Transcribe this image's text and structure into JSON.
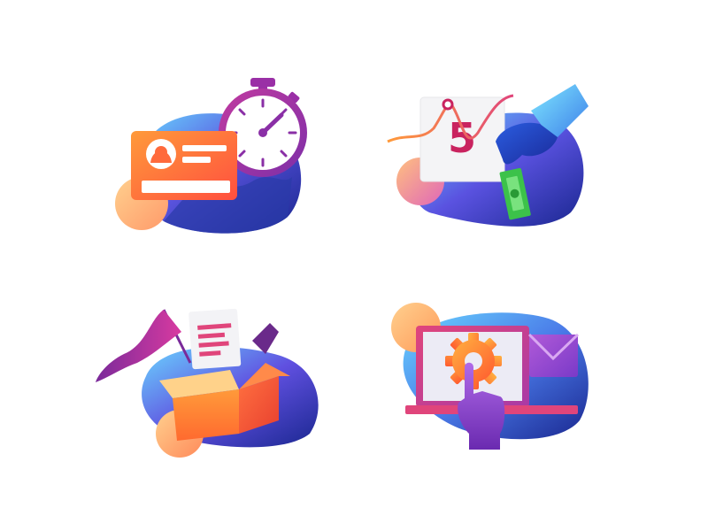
{
  "illustrations": {
    "id_card": {
      "icon": "id-card-stopwatch-icon"
    },
    "calendar": {
      "icon": "calendar-payment-icon",
      "day_number": "5"
    },
    "box": {
      "icon": "open-box-delivery-icon"
    },
    "settings": {
      "icon": "laptop-settings-mail-icon"
    }
  },
  "palette": {
    "blob_light": "#6ad6ff",
    "blob_dark": "#1b2a8f",
    "purple": "#7b3fe4",
    "magenta": "#b0309a",
    "orange": "#ff7a2f",
    "peach": "#ffc78a",
    "pink": "#e0457b",
    "green": "#3cc24a"
  }
}
